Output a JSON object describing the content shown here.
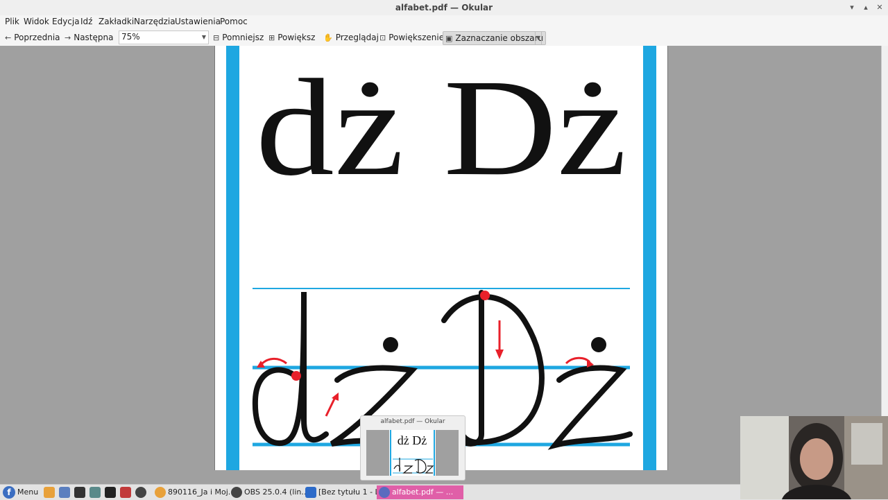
{
  "window": {
    "title": "alfabet.pdf — Okular"
  },
  "window_controls": {
    "minimize": "▾",
    "maximize": "▴",
    "close": "✕"
  },
  "menubar": {
    "items": [
      "Plik",
      "Widok",
      "Edycja",
      "Idź",
      "Zakładki",
      "Narzędzia",
      "Ustawienia",
      "Pomoc"
    ]
  },
  "toolbar": {
    "prev_label": "Poprzednia",
    "next_label": "Następna",
    "zoom_value": "75%",
    "zoom_out_label": "Pomniejsz",
    "zoom_in_label": "Powiększ",
    "browse_label": "Przeglądaj",
    "magnifier_label": "Powiększenie",
    "area_select_label": "Zaznaczanie obszaru"
  },
  "document": {
    "printed_text": "dż Dż",
    "cursive_text": "dż Dż",
    "accent_color": "#1ea7e1",
    "arrow_color": "#e8202a"
  },
  "preview_popup": {
    "title": "alfabet.pdf — Okular",
    "thumb_text": "dż Dż"
  },
  "taskbar": {
    "menu_label": "Menu",
    "tasks": [
      {
        "label": "890116_Ja i Moj...",
        "icon": "chrome-icon"
      },
      {
        "label": "OBS 25.0.4 (lin...",
        "icon": "obs-icon"
      },
      {
        "label": "[Bez tytułu 1 - L...",
        "icon": "writer-icon"
      },
      {
        "label": "alfabet.pdf — ...",
        "icon": "okular-icon"
      }
    ]
  }
}
